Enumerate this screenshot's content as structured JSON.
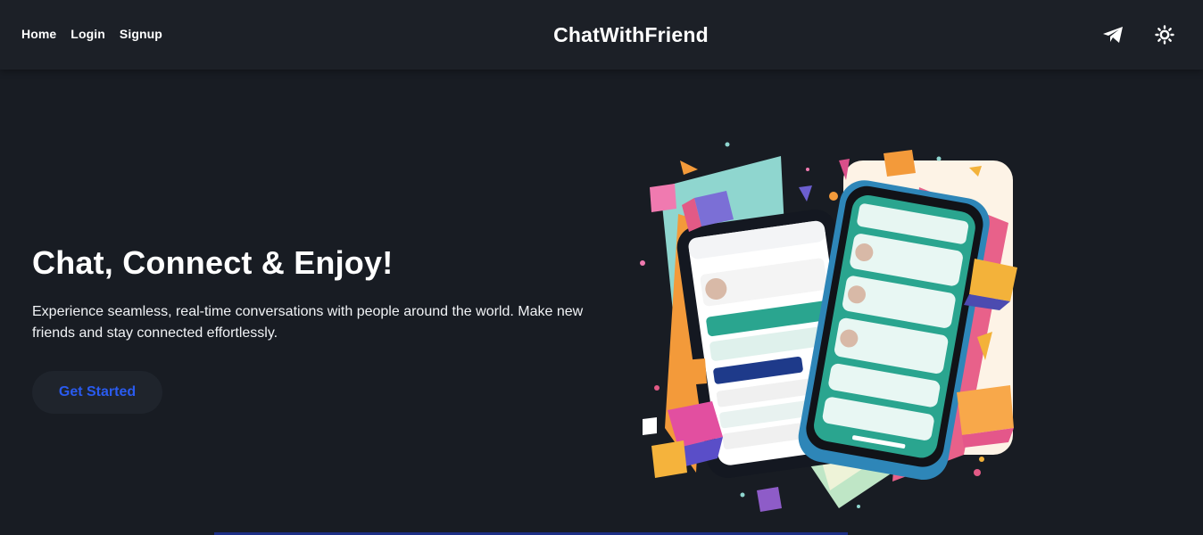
{
  "nav": {
    "links": [
      {
        "label": "Home"
      },
      {
        "label": "Login"
      },
      {
        "label": "Signup"
      }
    ],
    "brand": "ChatWithFriend",
    "icons": [
      "send-icon",
      "sun-icon"
    ]
  },
  "hero": {
    "title": "Chat, Connect & Enjoy!",
    "subtitle": "Experience seamless, real-time conversations with people around the world. Make new friends and stay connected effortlessly.",
    "cta_label": "Get Started"
  },
  "colors": {
    "background": "#181c23",
    "navbar": "#1c2027",
    "cta_text": "#2a5bf0",
    "accent_teal": "#2aa58f",
    "accent_pink": "#e8618a",
    "accent_orange": "#f39a3a"
  }
}
